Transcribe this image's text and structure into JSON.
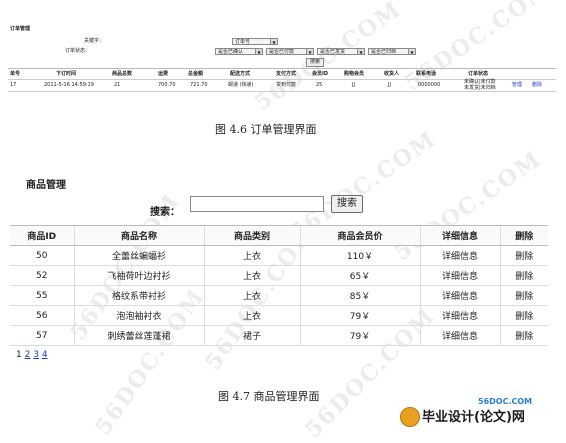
{
  "order_panel": {
    "title": "订单管理",
    "keyword_label": "关键字：",
    "keyword_select": "订单号",
    "status_label": "订单状态：",
    "status_selects": [
      "是否已确认",
      "是否已付款",
      "是否已发货",
      "是否已归档"
    ],
    "search_button": "搜索",
    "headers": [
      "单号",
      "下订时间",
      "商品总数",
      "运费",
      "总金额",
      "配送方式",
      "支付方式",
      "会员ID",
      "购物会员",
      "收货人",
      "联系电话",
      "订单状态"
    ],
    "row": {
      "id": "17",
      "time": "2011-5-16 14:59:19",
      "count": "21",
      "freight": "700.70",
      "total": "721.70",
      "delivery": "邮递 (快递)",
      "payment": "货到付款",
      "member_id": "25",
      "member": "JJ",
      "receiver": "JJ",
      "phone": "0000000",
      "status_line1": "未确认|未付款",
      "status_line2": "未发货|未归档",
      "manage_link": "管理",
      "delete_link": "删除"
    },
    "caption": "图 4.6  订单管理界面"
  },
  "product_panel": {
    "title": "商品管理",
    "search_label": "搜索：",
    "search_value": "",
    "search_button": "搜索",
    "headers": [
      "商品ID",
      "商品名称",
      "商品类别",
      "商品会员价",
      "详细信息",
      "删除"
    ],
    "rows": [
      {
        "id": "50",
        "name": "全蕾丝蝙蝠衫",
        "category": "上衣",
        "price": "110￥",
        "detail": "详细信息",
        "del": "删除"
      },
      {
        "id": "52",
        "name": "飞袖荷叶边衬衫",
        "category": "上衣",
        "price": "65￥",
        "detail": "详细信息",
        "del": "删除"
      },
      {
        "id": "55",
        "name": "格纹系带衬衫",
        "category": "上衣",
        "price": "85￥",
        "detail": "详细信息",
        "del": "删除"
      },
      {
        "id": "56",
        "name": "泡泡袖衬衣",
        "category": "上衣",
        "price": "79￥",
        "detail": "详细信息",
        "del": "删除"
      },
      {
        "id": "57",
        "name": "刺绣蕾丝莲蓬裙",
        "category": "裙子",
        "price": "79￥",
        "detail": "详细信息",
        "del": "删除"
      }
    ],
    "pagination": [
      "1",
      "2",
      "3",
      "4"
    ],
    "caption": "图 4.7  商品管理界面"
  },
  "watermarks": [
    "56DOC.COM",
    "56DOC.COM",
    "56DOC.COM",
    "56DOC.COM",
    "56DOC.COM",
    "56DOC.COM",
    "56DOC.COM",
    "56DOC.COM"
  ],
  "site_url": "56DOC.COM",
  "logo_text": "毕业设计(论文)网"
}
